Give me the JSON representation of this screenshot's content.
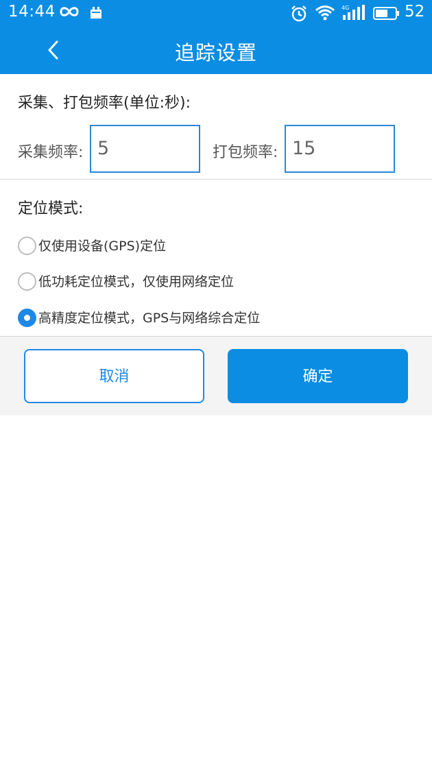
{
  "status_bar": {
    "time": "14:44",
    "battery_level": "52",
    "icons": [
      "infinity-icon",
      "calendar-icon",
      "alarm-icon",
      "wifi-icon",
      "4g-signal-icon",
      "battery-icon"
    ],
    "network_label": "4G"
  },
  "header": {
    "title": "追踪设置",
    "back_icon": "chevron-left-icon",
    "color": "#0a8de3"
  },
  "frequency": {
    "heading": "采集、打包频率(单位:秒):",
    "collect_label": "采集频率:",
    "collect_value": "5",
    "pack_label": "打包频率:",
    "pack_value": "15"
  },
  "location_mode": {
    "heading": "定位模式:",
    "options": [
      {
        "label": "仅使用设备(GPS)定位",
        "checked": false
      },
      {
        "label": "低功耗定位模式，仅使用网络定位",
        "checked": false
      },
      {
        "label": "高精度定位模式，GPS与网络综合定位",
        "checked": true
      }
    ]
  },
  "actions": {
    "cancel_label": "取消",
    "confirm_label": "确定",
    "accent_color": "#1e88e5"
  }
}
